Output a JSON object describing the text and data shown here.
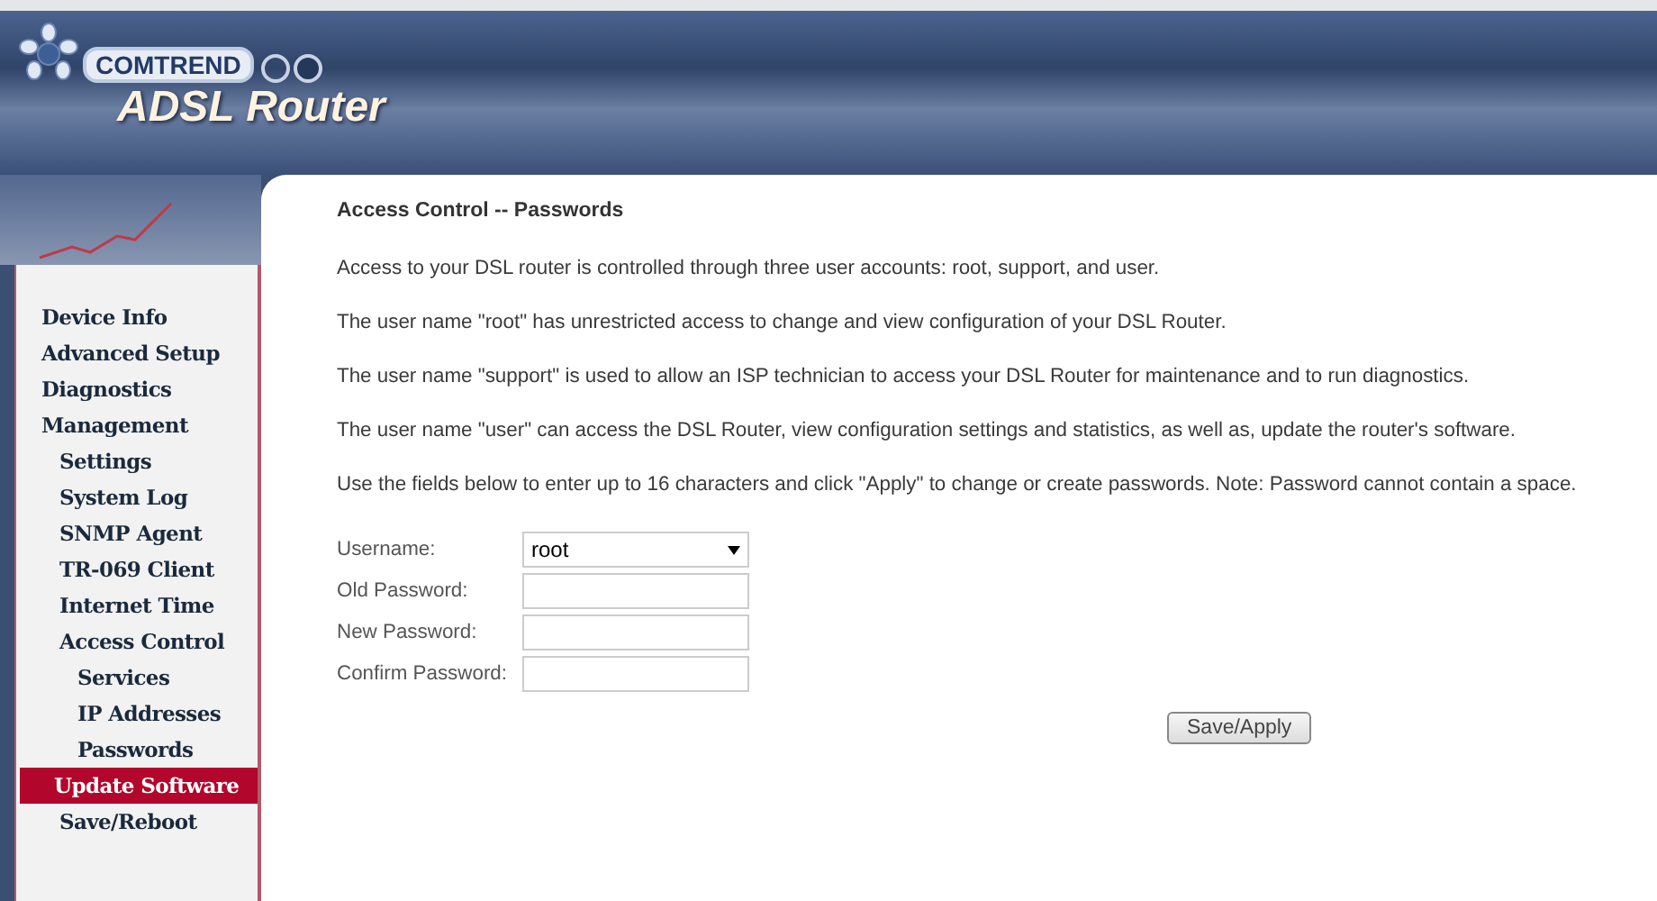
{
  "header": {
    "brand": "COMTREND",
    "product": "ADSL Router"
  },
  "sidebar": {
    "items": [
      {
        "label": "Device Info",
        "selected": false
      },
      {
        "label": "Advanced Setup",
        "selected": false
      },
      {
        "label": "Diagnostics",
        "selected": false
      },
      {
        "label": "Management",
        "selected": false,
        "children": [
          {
            "label": "Settings",
            "selected": false
          },
          {
            "label": "System Log",
            "selected": false
          },
          {
            "label": "SNMP Agent",
            "selected": false
          },
          {
            "label": "TR-069 Client",
            "selected": false
          },
          {
            "label": "Internet Time",
            "selected": false
          },
          {
            "label": "Access Control",
            "selected": false,
            "children": [
              {
                "label": "Services",
                "selected": false
              },
              {
                "label": "IP Addresses",
                "selected": false
              },
              {
                "label": "Passwords",
                "selected": false
              }
            ]
          },
          {
            "label": "Update Software",
            "selected": true
          },
          {
            "label": "Save/Reboot",
            "selected": false
          }
        ]
      }
    ]
  },
  "content": {
    "title": "Access Control -- Passwords",
    "paragraphs": [
      "Access to your DSL router is controlled through three user accounts: root, support, and user.",
      "The user name \"root\" has unrestricted access to change and view configuration of your DSL Router.",
      "The user name \"support\" is used to allow an ISP technician to access your DSL Router for maintenance and to run diagnostics.",
      "The user name \"user\" can access the DSL Router, view configuration settings and statistics, as well as, update the router's software.",
      "Use the fields below to enter up to 16 characters and click \"Apply\" to change or create passwords. Note: Password cannot contain a space."
    ],
    "form": [
      {
        "kind": "select",
        "label": "Username:",
        "value": "root"
      },
      {
        "kind": "password",
        "label": "Old Password:"
      },
      {
        "kind": "password",
        "label": "New Password:"
      },
      {
        "kind": "password",
        "label": "Confirm Password:"
      }
    ],
    "button": "Save/Apply"
  }
}
